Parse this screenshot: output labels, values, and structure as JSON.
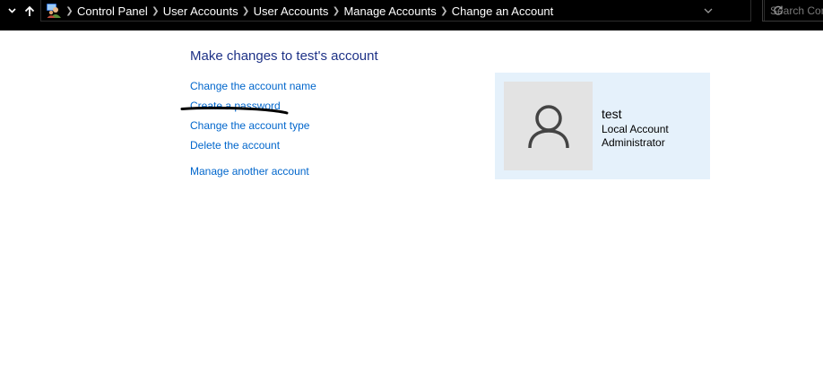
{
  "address_bar": {
    "breadcrumbs": [
      "Control Panel",
      "User Accounts",
      "User Accounts",
      "Manage Accounts",
      "Change an Account"
    ],
    "search_placeholder": "Search Con",
    "icons": {
      "recent": "chevron-down-icon",
      "up": "up-arrow-icon",
      "location": "control-panel-users-icon",
      "dropdown": "chevron-down-icon",
      "refresh": "refresh-icon"
    }
  },
  "main": {
    "title": "Make changes to test's account",
    "links": [
      "Change the account name",
      "Create a password",
      "Change the account type",
      "Delete the account",
      "Manage another account"
    ]
  },
  "account": {
    "name": "test",
    "type": "Local Account",
    "role": "Administrator",
    "avatar_icon": "user-icon"
  },
  "colors": {
    "title": "#1e3287",
    "link": "#0066cc",
    "tile_background": "#e5f1fb",
    "avatar_background": "#e3e3e3",
    "address_bar": "#000000"
  }
}
